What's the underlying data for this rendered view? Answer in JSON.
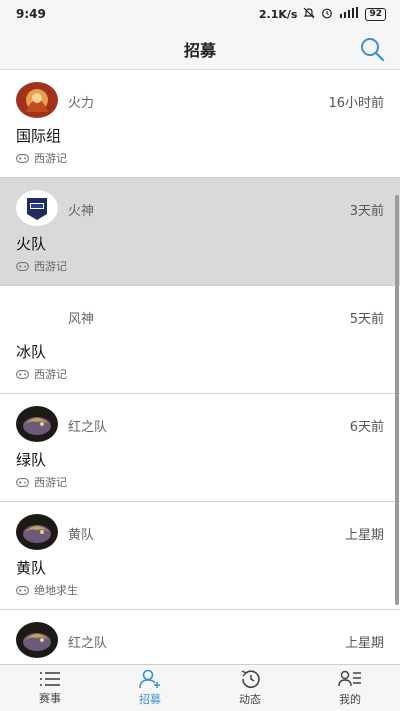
{
  "status_bar": {
    "time": "9:49",
    "speed": "2.1K/s",
    "battery": "92"
  },
  "header": {
    "title": "招募"
  },
  "colors": {
    "accent": "#3b8fd6",
    "selected_row": "#d9d9d9"
  },
  "recruit_list": [
    {
      "name": "火力",
      "time": "16小时前",
      "team": "国际组",
      "game": "西游记",
      "avatar": "fire-avatar"
    },
    {
      "name": "火神",
      "time": "3天前",
      "team": "火队",
      "game": "西游记",
      "avatar": "hero-logo-avatar"
    },
    {
      "name": "风神",
      "time": "5天前",
      "team": "冰队",
      "game": "西游记",
      "avatar": ""
    },
    {
      "name": "红之队",
      "time": "6天前",
      "team": "绿队",
      "game": "西游记",
      "avatar": "dragon-avatar"
    },
    {
      "name": "黄队",
      "time": "上星期",
      "team": "黄队",
      "game": "绝地求生",
      "avatar": "dragon-avatar"
    },
    {
      "name": "红之队",
      "time": "上星期",
      "team": "",
      "game": "",
      "avatar": "dragon-avatar"
    }
  ],
  "tab_bar": [
    {
      "label": "赛事",
      "icon": "list-icon"
    },
    {
      "label": "招募",
      "icon": "add-user-icon",
      "active": true
    },
    {
      "label": "动态",
      "icon": "history-icon"
    },
    {
      "label": "我的",
      "icon": "profile-icon"
    }
  ]
}
